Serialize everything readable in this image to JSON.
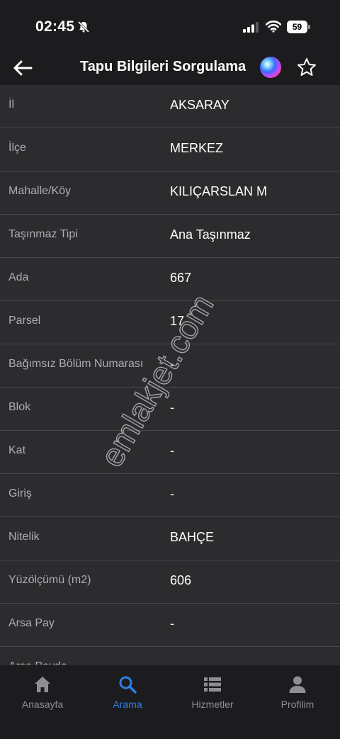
{
  "status_bar": {
    "time": "02:45",
    "battery": "59"
  },
  "nav": {
    "title": "Tapu Bilgileri Sorgulama"
  },
  "rows": [
    {
      "label": "İl",
      "value": "AKSARAY"
    },
    {
      "label": "İlçe",
      "value": "MERKEZ"
    },
    {
      "label": "Mahalle/Köy",
      "value": "KILIÇARSLAN M"
    },
    {
      "label": "Taşınmaz Tipi",
      "value": "Ana Taşınmaz"
    },
    {
      "label": "Ada",
      "value": "667"
    },
    {
      "label": "Parsel",
      "value": "17"
    },
    {
      "label": "Bağımsız Bölüm Numarası",
      "value": "-"
    },
    {
      "label": "Blok",
      "value": "-"
    },
    {
      "label": "Kat",
      "value": "-"
    },
    {
      "label": "Giriş",
      "value": "-"
    },
    {
      "label": "Nitelik",
      "value": "BAHÇE"
    },
    {
      "label": "Yüzölçümü (m2)",
      "value": "606"
    },
    {
      "label": "Arsa Pay",
      "value": "-"
    },
    {
      "label": "Arsa Payda",
      "value": ""
    }
  ],
  "watermark": "emlakjet.com",
  "tabs": [
    {
      "label": "Anasayfa",
      "icon": "home-icon",
      "active": false
    },
    {
      "label": "Arama",
      "icon": "search-icon",
      "active": true
    },
    {
      "label": "Hizmetler",
      "icon": "list-icon",
      "active": false
    },
    {
      "label": "Profilim",
      "icon": "profile-icon",
      "active": false
    }
  ],
  "colors": {
    "accent": "#2f7ee6",
    "background": "#2c2c2e",
    "bar": "#1c1c1e",
    "divider": "#48484a",
    "label": "#aeaeb2"
  }
}
